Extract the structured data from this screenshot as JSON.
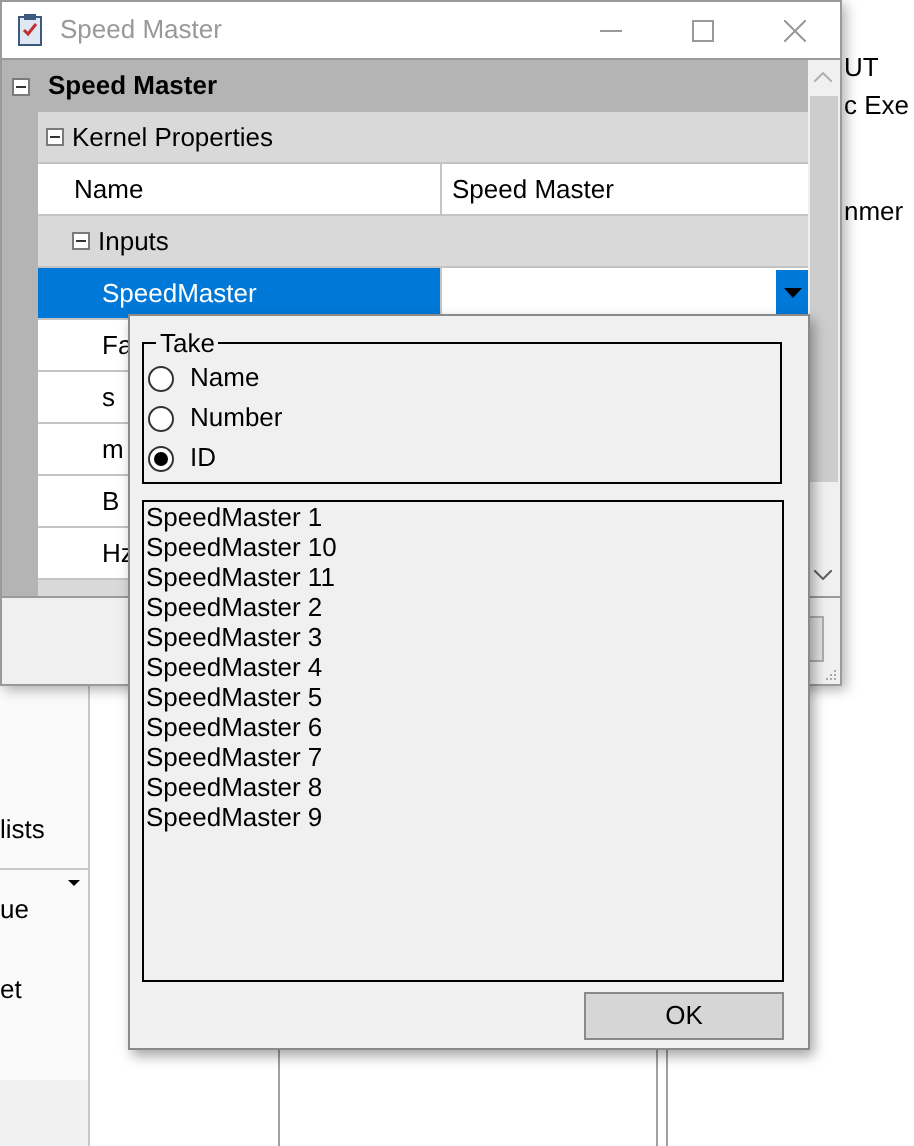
{
  "background": {
    "right_texts": [
      "UT",
      "c Exe",
      "nmer"
    ],
    "sidebar_items": [
      {
        "label": "lists",
        "has_caret": false
      },
      {
        "label": "ue",
        "has_caret": true
      },
      {
        "label": "et",
        "has_caret": false
      }
    ]
  },
  "window": {
    "title": "Speed Master"
  },
  "property_grid": {
    "title": "Speed Master",
    "expanded": true,
    "categories": [
      {
        "label": "Kernel Properties",
        "expanded": true,
        "rows": [
          {
            "kind": "property",
            "name": "Name",
            "value": "Speed Master",
            "selected": false
          },
          {
            "kind": "category",
            "name": "Inputs",
            "expanded": true
          },
          {
            "kind": "property",
            "name": "SpeedMaster",
            "value": "",
            "selected": true,
            "dropdown": true
          },
          {
            "kind": "property",
            "name": "Fa",
            "selected": false
          },
          {
            "kind": "property",
            "name": "s",
            "selected": false
          },
          {
            "kind": "property",
            "name": "m",
            "selected": false
          },
          {
            "kind": "property",
            "name": "B",
            "selected": false
          },
          {
            "kind": "property",
            "name": "Hz",
            "selected": false
          }
        ]
      }
    ]
  },
  "popup": {
    "group_label": "Take",
    "options": [
      {
        "label": "Name",
        "selected": false
      },
      {
        "label": "Number",
        "selected": false
      },
      {
        "label": "ID",
        "selected": true
      }
    ],
    "items": [
      "SpeedMaster 1",
      "SpeedMaster 10",
      "SpeedMaster 11",
      "SpeedMaster 2",
      "SpeedMaster 3",
      "SpeedMaster 4",
      "SpeedMaster 5",
      "SpeedMaster 6",
      "SpeedMaster 7",
      "SpeedMaster 8",
      "SpeedMaster 9"
    ],
    "ok_button": "OK"
  }
}
